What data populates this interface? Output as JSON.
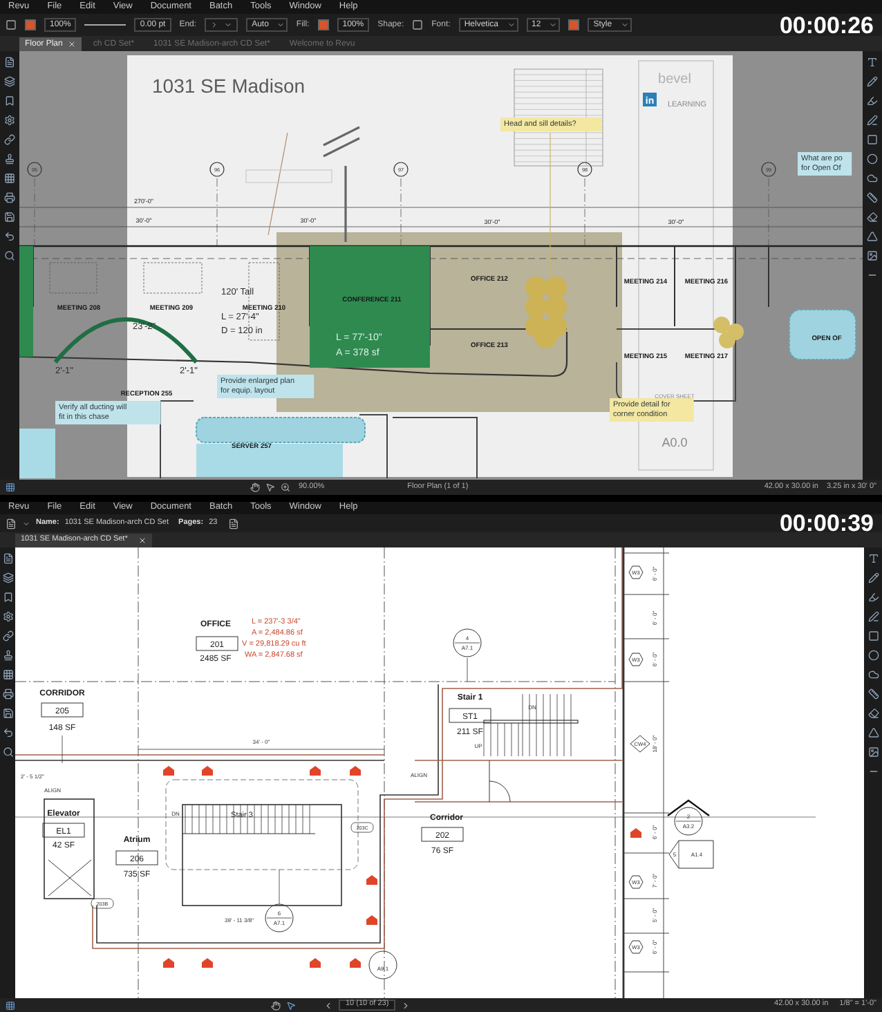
{
  "top_frame": {
    "menu": [
      "Revu",
      "File",
      "Edit",
      "View",
      "Document",
      "Batch",
      "Tools",
      "Window",
      "Help"
    ],
    "toolbar": [
      {
        "kind": "field",
        "text": "100%"
      },
      {
        "kind": "field",
        "text": "0.00 pt"
      },
      {
        "kind": "label",
        "text": "End:"
      },
      {
        "kind": "dropdown",
        "text": "Auto"
      },
      {
        "kind": "label",
        "text": "Fill:"
      },
      {
        "kind": "field",
        "text": "100%"
      },
      {
        "kind": "label",
        "text": "Shape:"
      },
      {
        "kind": "label",
        "text": "Font:"
      },
      {
        "kind": "dropdown",
        "text": "Helvetica"
      },
      {
        "kind": "dropdown",
        "text": "12"
      },
      {
        "kind": "dropdown",
        "text": "Style"
      }
    ],
    "timestamp": "00:00:26",
    "tabs": [
      {
        "label": "Floor Plan",
        "selected": true
      },
      {
        "label": "ch CD Set*",
        "selected": false
      },
      {
        "label": "1031 SE Madison-arch CD Set*",
        "selected": false
      },
      {
        "label": "Welcome to Revu",
        "selected": false
      }
    ],
    "drawing": {
      "labels": [
        {
          "kind": "title",
          "text": "1031 SE Madison"
        },
        {
          "kind": "logo_text",
          "text": "bevel"
        },
        {
          "kind": "logo_badge",
          "text": "in"
        },
        {
          "kind": "logo_caption",
          "text": "LEARNING"
        },
        {
          "kind": "grid",
          "text": "95"
        },
        {
          "kind": "grid",
          "text": "96"
        },
        {
          "kind": "grid",
          "text": "97"
        },
        {
          "kind": "grid",
          "text": "98"
        },
        {
          "kind": "grid",
          "text": "99"
        },
        {
          "kind": "dim",
          "text": "270'-0\""
        },
        {
          "kind": "dim",
          "text": "30'-0\""
        },
        {
          "kind": "dim",
          "text": "30'-0\""
        },
        {
          "kind": "dim",
          "text": "30'-0\""
        },
        {
          "kind": "dim",
          "text": "30'-0\""
        },
        {
          "kind": "callout",
          "color": "#f3e7a1",
          "lines": [
            "Head and sill details?"
          ]
        },
        {
          "kind": "callout",
          "color": "#bfe3ea",
          "lines": [
            "What are po",
            "for Open Of"
          ]
        },
        {
          "kind": "room",
          "text": "MEETING 208"
        },
        {
          "kind": "room",
          "text": "MEETING 209"
        },
        {
          "kind": "room",
          "text": "MEETING 210"
        },
        {
          "kind": "room",
          "text": "CONFERENCE 211"
        },
        {
          "kind": "measure_light",
          "text": "L = 77'-10\""
        },
        {
          "kind": "measure_light",
          "text": "A = 378 sf"
        },
        {
          "kind": "room",
          "text": "OFFICE 212"
        },
        {
          "kind": "room",
          "text": "OFFICE 213"
        },
        {
          "kind": "room",
          "text": "MEETING 214"
        },
        {
          "kind": "room",
          "text": "MEETING 216"
        },
        {
          "kind": "room",
          "text": "MEETING 215"
        },
        {
          "kind": "room",
          "text": "MEETING 217"
        },
        {
          "kind": "room",
          "text": "OPEN OF"
        },
        {
          "kind": "measure",
          "text": "120' Tall"
        },
        {
          "kind": "measure",
          "text": "L = 27'-4\""
        },
        {
          "kind": "measure",
          "text": "D = 120 in"
        },
        {
          "kind": "measure",
          "text": "23'-2\""
        },
        {
          "kind": "measure",
          "text": "2'-1\""
        },
        {
          "kind": "measure",
          "text": "2'-1\""
        },
        {
          "kind": "room",
          "text": "RECEPTION 255"
        },
        {
          "kind": "callout",
          "color": "#bfe3ea",
          "lines": [
            "Provide enlarged plan",
            "for equip. layout"
          ]
        },
        {
          "kind": "callout",
          "color": "#bfe3ea",
          "lines": [
            "Verify all ducting will",
            "fit in this chase"
          ]
        },
        {
          "kind": "room",
          "text": "SERVER 257"
        },
        {
          "kind": "callout",
          "color": "#f3e7a1",
          "lines": [
            "Provide detail for",
            "corner condition"
          ]
        },
        {
          "kind": "sheet_small",
          "text": "COVER SHEET"
        },
        {
          "kind": "sheet_number",
          "text": "A0.0"
        }
      ]
    },
    "status_bar": {
      "zoom": "90.00%",
      "page": "Floor Plan (1 of 1)",
      "size": "42.00 x 30.00 in",
      "cursor": "3.25 in x 30' 0\""
    }
  },
  "bottom_frame": {
    "menu": [
      "Revu",
      "File",
      "Edit",
      "View",
      "Document",
      "Batch",
      "Tools",
      "Window",
      "Help"
    ],
    "document": {
      "name_label": "Name:",
      "name": "1031 SE Madison-arch CD Set",
      "pages_label": "Pages:",
      "pages": "23"
    },
    "timestamp": "00:00:39",
    "tabs": [
      {
        "label": "1031 SE Madison-arch CD Set*",
        "selected": true
      }
    ],
    "drawing": {
      "labels": [
        {
          "kind": "room_name",
          "text": "OFFICE"
        },
        {
          "kind": "room_number",
          "text": "201"
        },
        {
          "kind": "area",
          "text": "2485 SF"
        },
        {
          "kind": "red",
          "text": "L = 237'-3 3/4\""
        },
        {
          "kind": "red",
          "text": "A = 2,484.86 sf"
        },
        {
          "kind": "red",
          "text": "V = 29,818.29 cu ft"
        },
        {
          "kind": "red",
          "text": "WA = 2,847.68 sf"
        },
        {
          "kind": "room_name",
          "text": "CORRIDOR"
        },
        {
          "kind": "room_number",
          "text": "205"
        },
        {
          "kind": "area",
          "text": "148 SF"
        },
        {
          "kind": "dim",
          "text": "34' - 0\""
        },
        {
          "kind": "dim",
          "text": "2' - 5 1/2\""
        },
        {
          "kind": "dim",
          "text": "ALIGN"
        },
        {
          "kind": "dim",
          "text": "ALIGN"
        },
        {
          "kind": "room_name",
          "text": "Elevator"
        },
        {
          "kind": "room_number",
          "text": "EL1"
        },
        {
          "kind": "area",
          "text": "42 SF"
        },
        {
          "kind": "room_name",
          "text": "Atrium"
        },
        {
          "kind": "room_number",
          "text": "206"
        },
        {
          "kind": "area",
          "text": "735 SF"
        },
        {
          "kind": "dim",
          "text": "DN"
        },
        {
          "kind": "stair",
          "text": "Stair 3"
        },
        {
          "kind": "door_tag",
          "text": "203C"
        },
        {
          "kind": "door_tag",
          "text": "203B"
        },
        {
          "kind": "dim",
          "text": "39' - 11 3/8\""
        },
        {
          "kind": "section",
          "lines": [
            "6",
            "A7.1"
          ]
        },
        {
          "kind": "section",
          "lines": [
            "A9.1"
          ]
        },
        {
          "kind": "section",
          "lines": [
            "4",
            "A7.1"
          ]
        },
        {
          "kind": "room_name",
          "text": "Stair 1"
        },
        {
          "kind": "room_number",
          "text": "ST1"
        },
        {
          "kind": "area",
          "text": "211 SF"
        },
        {
          "kind": "dim",
          "text": "DN"
        },
        {
          "kind": "dim",
          "text": "UP"
        },
        {
          "kind": "room_name",
          "text": "Corridor"
        },
        {
          "kind": "room_number",
          "text": "202"
        },
        {
          "kind": "area",
          "text": "76 SF"
        },
        {
          "kind": "tag_diamond",
          "text": "CW4"
        },
        {
          "kind": "tag_hex",
          "text": "W3"
        },
        {
          "kind": "tag_hex",
          "text": "W3"
        },
        {
          "kind": "tag_hex",
          "text": "W3"
        },
        {
          "kind": "tag_hex",
          "text": "W3"
        },
        {
          "kind": "dim_v",
          "text": "6' - 0\""
        },
        {
          "kind": "dim_v",
          "text": "6' - 0\""
        },
        {
          "kind": "dim_v",
          "text": "6' - 0\""
        },
        {
          "kind": "dim_v",
          "text": "18' - 0\""
        },
        {
          "kind": "dim_v",
          "text": "6' - 0\""
        },
        {
          "kind": "dim_v",
          "text": "7' - 0\""
        },
        {
          "kind": "dim_v",
          "text": "5' - 0\""
        },
        {
          "kind": "dim_v",
          "text": "6' - 0\""
        },
        {
          "kind": "section_arrow",
          "lines": [
            "2",
            "A3.2"
          ]
        },
        {
          "kind": "ref_tag",
          "lines": [
            "5",
            "A1.4"
          ]
        }
      ]
    },
    "status_bar": {
      "page": "10 (10 of 23)",
      "size": "42.00 x 30.00 in",
      "scale": "1/8\" = 1'-0\""
    }
  }
}
